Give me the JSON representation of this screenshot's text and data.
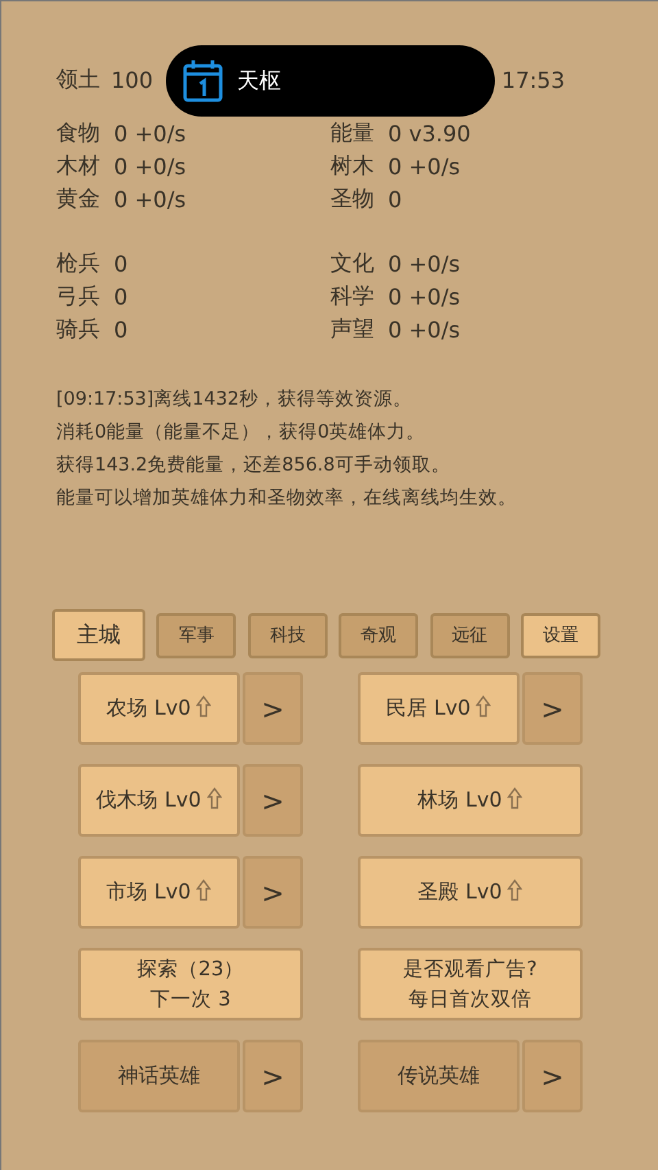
{
  "header": {
    "label": "领土",
    "value": "100",
    "time_fragment": "17:53"
  },
  "toast": {
    "title": "天枢"
  },
  "resources": [
    {
      "label": "食物",
      "value": "0 +0/s"
    },
    {
      "label": "能量",
      "value": "0  v3.90"
    },
    {
      "label": "木材",
      "value": "0 +0/s"
    },
    {
      "label": "树木",
      "value": "0 +0/s"
    },
    {
      "label": "黄金",
      "value": "0 +0/s"
    },
    {
      "label": "圣物",
      "value": "0"
    }
  ],
  "units": [
    {
      "label": "枪兵",
      "value": "0"
    },
    {
      "label": "文化",
      "value": "0 +0/s"
    },
    {
      "label": "弓兵",
      "value": "0"
    },
    {
      "label": "科学",
      "value": "0 +0/s"
    },
    {
      "label": "骑兵",
      "value": "0"
    },
    {
      "label": "声望",
      "value": "0 +0/s"
    }
  ],
  "log": [
    "[09:17:53]离线1432秒，获得等效资源。",
    "消耗0能量（能量不足），获得0英雄体力。",
    "获得143.2免费能量，还差856.8可手动领取。",
    "能量可以增加英雄体力和圣物效率，在线离线均生效。"
  ],
  "tabs": [
    {
      "label": "主城",
      "selected": true
    },
    {
      "label": "军事",
      "selected": false
    },
    {
      "label": "科技",
      "selected": false
    },
    {
      "label": "奇观",
      "selected": false
    },
    {
      "label": "远征",
      "selected": false
    }
  ],
  "settings_button": {
    "label": "设置"
  },
  "buttons": [
    {
      "kind": "building",
      "label": "农场 Lv0",
      "arrow": ">"
    },
    {
      "kind": "building",
      "label": "民居 Lv0",
      "arrow": ">"
    },
    {
      "kind": "building",
      "label": "伐木场 Lv0",
      "arrow": ">"
    },
    {
      "kind": "building",
      "label": "林场 Lv0"
    },
    {
      "kind": "building",
      "label": "市场 Lv0",
      "arrow": ">"
    },
    {
      "kind": "building",
      "label": "圣殿 Lv0"
    },
    {
      "kind": "plain",
      "lines": [
        "探索（23）",
        "下一次 3"
      ]
    },
    {
      "kind": "plain",
      "lines": [
        "是否观看广告?",
        "每日首次双倍"
      ]
    },
    {
      "kind": "hero",
      "label": "神话英雄",
      "arrow": ">"
    },
    {
      "kind": "hero",
      "label": "传说英雄",
      "arrow": ">"
    }
  ]
}
